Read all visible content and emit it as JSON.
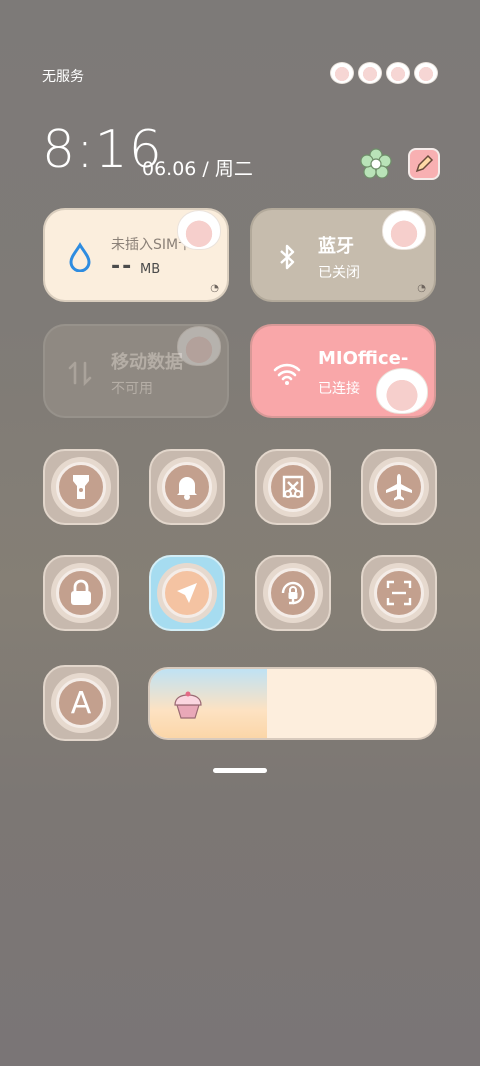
{
  "status_bar": {
    "carrier": "无服务"
  },
  "header": {
    "time": "8:16",
    "date": "06.06 / 周二"
  },
  "tiles": {
    "sim": {
      "title": "未插入SIM卡",
      "value": "--",
      "unit": "MB",
      "icon": "droplet-icon"
    },
    "bluetooth": {
      "title": "蓝牙",
      "status": "已关闭",
      "icon": "bluetooth-icon"
    },
    "mobile_data": {
      "title": "移动数据",
      "status": "不可用",
      "icon": "data-arrows-icon"
    },
    "wifi": {
      "title": "MIOffice-",
      "status": "已连接",
      "icon": "wifi-icon"
    }
  },
  "toggles": [
    {
      "name": "flashlight",
      "icon": "flashlight-icon",
      "active": false
    },
    {
      "name": "sound",
      "icon": "bell-icon",
      "active": false
    },
    {
      "name": "screenshot",
      "icon": "scissors-icon",
      "active": false
    },
    {
      "name": "airplane-mode",
      "icon": "airplane-icon",
      "active": false
    },
    {
      "name": "lock-screen",
      "icon": "lock-icon",
      "active": false
    },
    {
      "name": "location",
      "icon": "location-arrow-icon",
      "active": true
    },
    {
      "name": "rotation-lock",
      "icon": "rotation-lock-icon",
      "active": false
    },
    {
      "name": "scanner",
      "icon": "scan-icon",
      "active": false
    },
    {
      "name": "auto-brightness",
      "icon": "letter-a-icon",
      "active": false
    }
  ],
  "toggle_letter": "A",
  "brightness": {
    "level": 0.41,
    "icon": "cupcake-icon"
  },
  "colors": {
    "sim_tile": "#fbeedd",
    "bt_tile": "#c6bcad",
    "wifi_tile": "#f9a7a9",
    "location_active": "#a6dcf0"
  }
}
